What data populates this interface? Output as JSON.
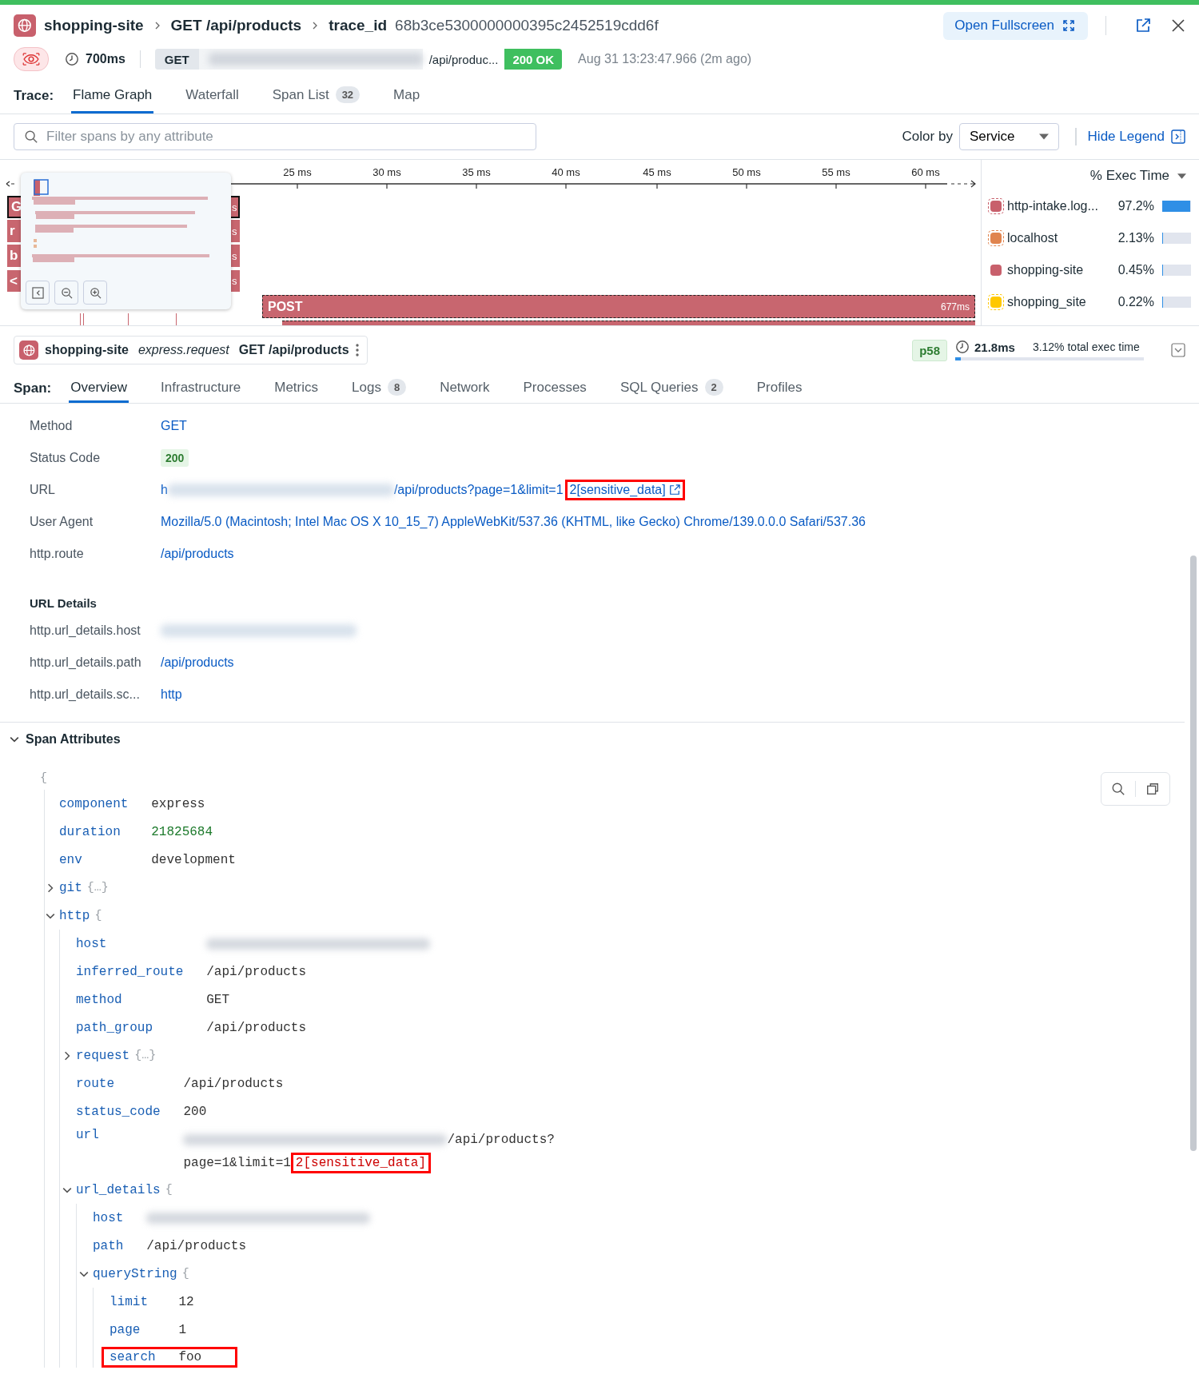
{
  "breadcrumb": {
    "service": "shopping-site",
    "resource": "GET /api/products",
    "trace_label": "trace_id",
    "trace_id": "68b3ce5300000000395c2452519cdd6f"
  },
  "actions": {
    "fullscreen": "Open Fullscreen"
  },
  "summary": {
    "duration": "700ms",
    "method": "GET",
    "url_path": "/api/produc...",
    "status": "200 OK",
    "time": "Aug 31 13:23:47.966 (2m ago)"
  },
  "trace_tabs": {
    "label": "Trace:",
    "tabs": [
      {
        "label": "Flame Graph",
        "selected": true
      },
      {
        "label": "Waterfall",
        "selected": false
      },
      {
        "label": "Span List",
        "count": "32",
        "selected": false
      },
      {
        "label": "Map",
        "selected": false
      }
    ]
  },
  "filter": {
    "placeholder": "Filter spans by any attribute"
  },
  "color_by": {
    "label": "Color by",
    "value": "Service"
  },
  "legend_toggle": "Hide Legend",
  "flame": {
    "ticks": [
      "25 ms",
      "30 ms",
      "35 ms",
      "40 ms",
      "45 ms",
      "50 ms",
      "55 ms",
      "60 ms"
    ],
    "rows": [
      {
        "label": "G",
        "duration": "s",
        "selected": true
      },
      {
        "label": "r",
        "duration": "s",
        "selected": false
      },
      {
        "label": "b",
        "duration": "s",
        "selected": false
      },
      {
        "label": "<",
        "duration": "s",
        "selected": false
      }
    ],
    "post": {
      "label": "POST",
      "duration": "677ms"
    }
  },
  "legend": {
    "sort": "% Exec Time",
    "items": [
      {
        "name": "http-intake.log...",
        "percent": "97.2%",
        "level": 0.972,
        "color": "#c8606c",
        "outlined": true
      },
      {
        "name": "localhost",
        "percent": "2.13%",
        "level": 0.0213,
        "color": "#e0844f",
        "outlined": true
      },
      {
        "name": "shopping-site",
        "percent": "0.45%",
        "level": 0.0045,
        "color": "#c8606c",
        "outlined": false
      },
      {
        "name": "shopping_site",
        "percent": "0.22%",
        "level": 0.0022,
        "color": "#ffc800",
        "outlined": true
      }
    ]
  },
  "span": {
    "service": "shopping-site",
    "operation": "express.request",
    "resource": "GET /api/products",
    "percentile": "p58",
    "duration": "21.8ms",
    "exec": "3.12% total exec time",
    "level": 0.0312
  },
  "span_tabs": {
    "label": "Span:",
    "tabs": [
      {
        "label": "Overview",
        "selected": true
      },
      {
        "label": "Infrastructure",
        "selected": false
      },
      {
        "label": "Metrics",
        "selected": false
      },
      {
        "label": "Logs",
        "count": "8",
        "selected": false
      },
      {
        "label": "Network",
        "selected": false
      },
      {
        "label": "Processes",
        "selected": false
      },
      {
        "label": "SQL Queries",
        "count": "2",
        "selected": false
      },
      {
        "label": "Profiles",
        "selected": false
      }
    ]
  },
  "properties": [
    {
      "label": "Method",
      "kind": "link",
      "value": "GET"
    },
    {
      "label": "Status Code",
      "kind": "badge",
      "value": "200"
    },
    {
      "label": "URL",
      "kind": "url",
      "prefix": "h",
      "value": "/api/products?page=1&limit=1",
      "highlight": "2[sensitive_data]"
    },
    {
      "label": "User Agent",
      "kind": "link",
      "value": "Mozilla/5.0 (Macintosh; Intel Mac OS X 10_15_7) AppleWebKit/537.36 (KHTML, like Gecko) Chrome/139.0.0.0 Safari/537.36"
    },
    {
      "label": "http.route",
      "kind": "link",
      "value": "/api/products"
    }
  ],
  "url_details": {
    "title": "URL Details",
    "rows": [
      {
        "label": "http.url_details.host",
        "kind": "blurred"
      },
      {
        "label": "http.url_details.path",
        "kind": "link",
        "value": "/api/products"
      },
      {
        "label": "http.url_details.sc...",
        "kind": "link",
        "value": "http"
      }
    ]
  },
  "attributes": {
    "title": "Span Attributes",
    "expanded": true,
    "open_brace": "{",
    "nodes": [
      {
        "key": "component",
        "kind": "string",
        "value": "express",
        "highlighted": false
      },
      {
        "key": "duration",
        "kind": "number",
        "value": "21825684",
        "highlighted": false
      },
      {
        "key": "env",
        "kind": "string",
        "value": "development",
        "highlighted": false
      },
      {
        "key": "git",
        "kind": "object",
        "expanded": false,
        "collapsed_text": "{…}",
        "highlighted": false
      },
      {
        "key": "http",
        "kind": "object",
        "expanded": true,
        "brace": "{",
        "highlighted": false,
        "children": [
          {
            "key": "host",
            "kind": "blurred",
            "highlighted": false
          },
          {
            "key": "inferred_route",
            "kind": "string",
            "value": "/api/products",
            "highlighted": false
          },
          {
            "key": "method",
            "kind": "string",
            "value": "GET",
            "highlighted": false
          },
          {
            "key": "path_group",
            "kind": "string",
            "value": "/api/products",
            "highlighted": false
          },
          {
            "key": "request",
            "kind": "object",
            "expanded": false,
            "collapsed_text": "{…}",
            "highlighted": false
          },
          {
            "key": "route",
            "kind": "string",
            "value": "/api/products",
            "highlighted": false
          },
          {
            "key": "status_code",
            "kind": "number_plain",
            "value": "200",
            "highlighted": false
          },
          {
            "key": "url",
            "kind": "url",
            "lines": [
              "/api/products?",
              "page=1&limit=1"
            ],
            "highlight": "2[sensitive_data]",
            "highlighted": false
          },
          {
            "key": "url_details",
            "kind": "object",
            "expanded": true,
            "brace": "{",
            "highlighted": false,
            "children": [
              {
                "key": "host",
                "kind": "blurred",
                "highlighted": false
              },
              {
                "key": "path",
                "kind": "string",
                "value": "/api/products",
                "highlighted": false
              },
              {
                "key": "queryString",
                "kind": "object",
                "expanded": true,
                "brace": "{",
                "highlighted": false,
                "children": [
                  {
                    "key": "limit",
                    "kind": "string",
                    "value": "12",
                    "highlighted": false
                  },
                  {
                    "key": "page",
                    "kind": "string",
                    "value": "1",
                    "highlighted": false
                  },
                  {
                    "key": "search",
                    "kind": "string",
                    "value": "foo",
                    "highlighted": true
                  }
                ]
              }
            ]
          }
        ]
      }
    ]
  }
}
